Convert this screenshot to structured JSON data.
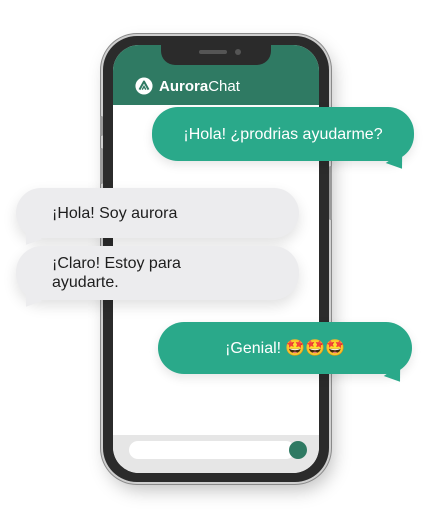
{
  "app": {
    "name_strong": "Aurora",
    "name_regular": "Chat",
    "logo_icon": "aurora-logo-icon",
    "header_color": "#2f7a63"
  },
  "messages": [
    {
      "sender": "user",
      "text": "¡Hola! ¿prodrias ayudarme?"
    },
    {
      "sender": "bot",
      "text": "¡Hola! Soy aurora"
    },
    {
      "sender": "bot",
      "text": "¡Claro! Estoy para ayudarte."
    },
    {
      "sender": "user",
      "text": "¡Genial!",
      "emoji": "🤩🤩🤩"
    }
  ],
  "composer": {
    "value": "",
    "placeholder": "",
    "send_icon": "send-icon"
  },
  "colors": {
    "user_bubble": "#2aa98a",
    "bot_bubble": "#ececee",
    "bot_text": "#1e1e1e"
  }
}
